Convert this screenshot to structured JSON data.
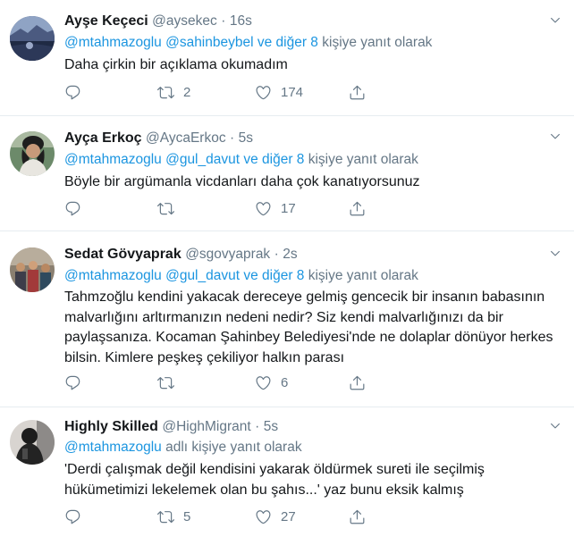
{
  "tweets": [
    {
      "name": "Ayşe Keçeci",
      "handle": "@aysekec",
      "dot": "·",
      "time": "16s",
      "reply_to": {
        "prefix": "@mtahmazoglu @sahinbeybel ve diğer 8",
        "suffix": " kişiye yanıt olarak"
      },
      "lines": [
        "Daha çirkin bir açıklama okumadım"
      ],
      "retweets": "2",
      "likes": "174",
      "avatar_icon": "landscape-photo-avatar"
    },
    {
      "name": "Ayça Erkoç",
      "handle": "@AycaErkoc",
      "dot": "·",
      "time": "5s",
      "reply_to": {
        "prefix": "@mtahmazoglu @gul_davut ve diğer 8",
        "suffix": " kişiye yanıt olarak"
      },
      "lines": [
        "Böyle bir argümanla vicdanları daha çok kanatıyorsunuz"
      ],
      "retweets": "",
      "likes": "17",
      "avatar_icon": "person-photo-avatar"
    },
    {
      "name": "Sedat Gövyaprak",
      "handle": "@sgovyaprak",
      "dot": "·",
      "time": "2s",
      "reply_to": {
        "prefix": "@mtahmazoglu @gul_davut ve diğer 8",
        "suffix": " kişiye yanıt olarak"
      },
      "lines": [
        "Tahmzoğlu kendini yakacak dereceye gelmiş gencecik bir insanın babasının",
        "malvarlığını arltırmanızın nedeni nedir? Siz kendi malvarlığınızı da bir",
        "paylaşsanıza. Kocaman Şahinbey Belediyesi'nde ne dolaplar dönüyor herkes",
        "bilsin. Kimlere peşkeş çekiliyor halkın parası"
      ],
      "retweets": "",
      "likes": "6",
      "avatar_icon": "group-photo-avatar"
    },
    {
      "name": "Highly Skilled",
      "handle": "@HighMigrant",
      "dot": "·",
      "time": "5s",
      "reply_to": {
        "prefix": "@mtahmazoglu",
        "suffix": " adlı kişiye yanıt olarak"
      },
      "lines": [
        "'Derdi çalışmak değil kendisini yakarak öldürmek sureti ile seçilmiş",
        "hükümetimizi lekelemek olan bu şahıs...' yaz bunu eksik kalmış"
      ],
      "retweets": "5",
      "likes": "27",
      "avatar_icon": "dark-figure-avatar"
    }
  ],
  "colors": {
    "text": "#14171a",
    "muted": "#657786",
    "link": "#1b95e0",
    "divider": "#e6ecf0"
  }
}
